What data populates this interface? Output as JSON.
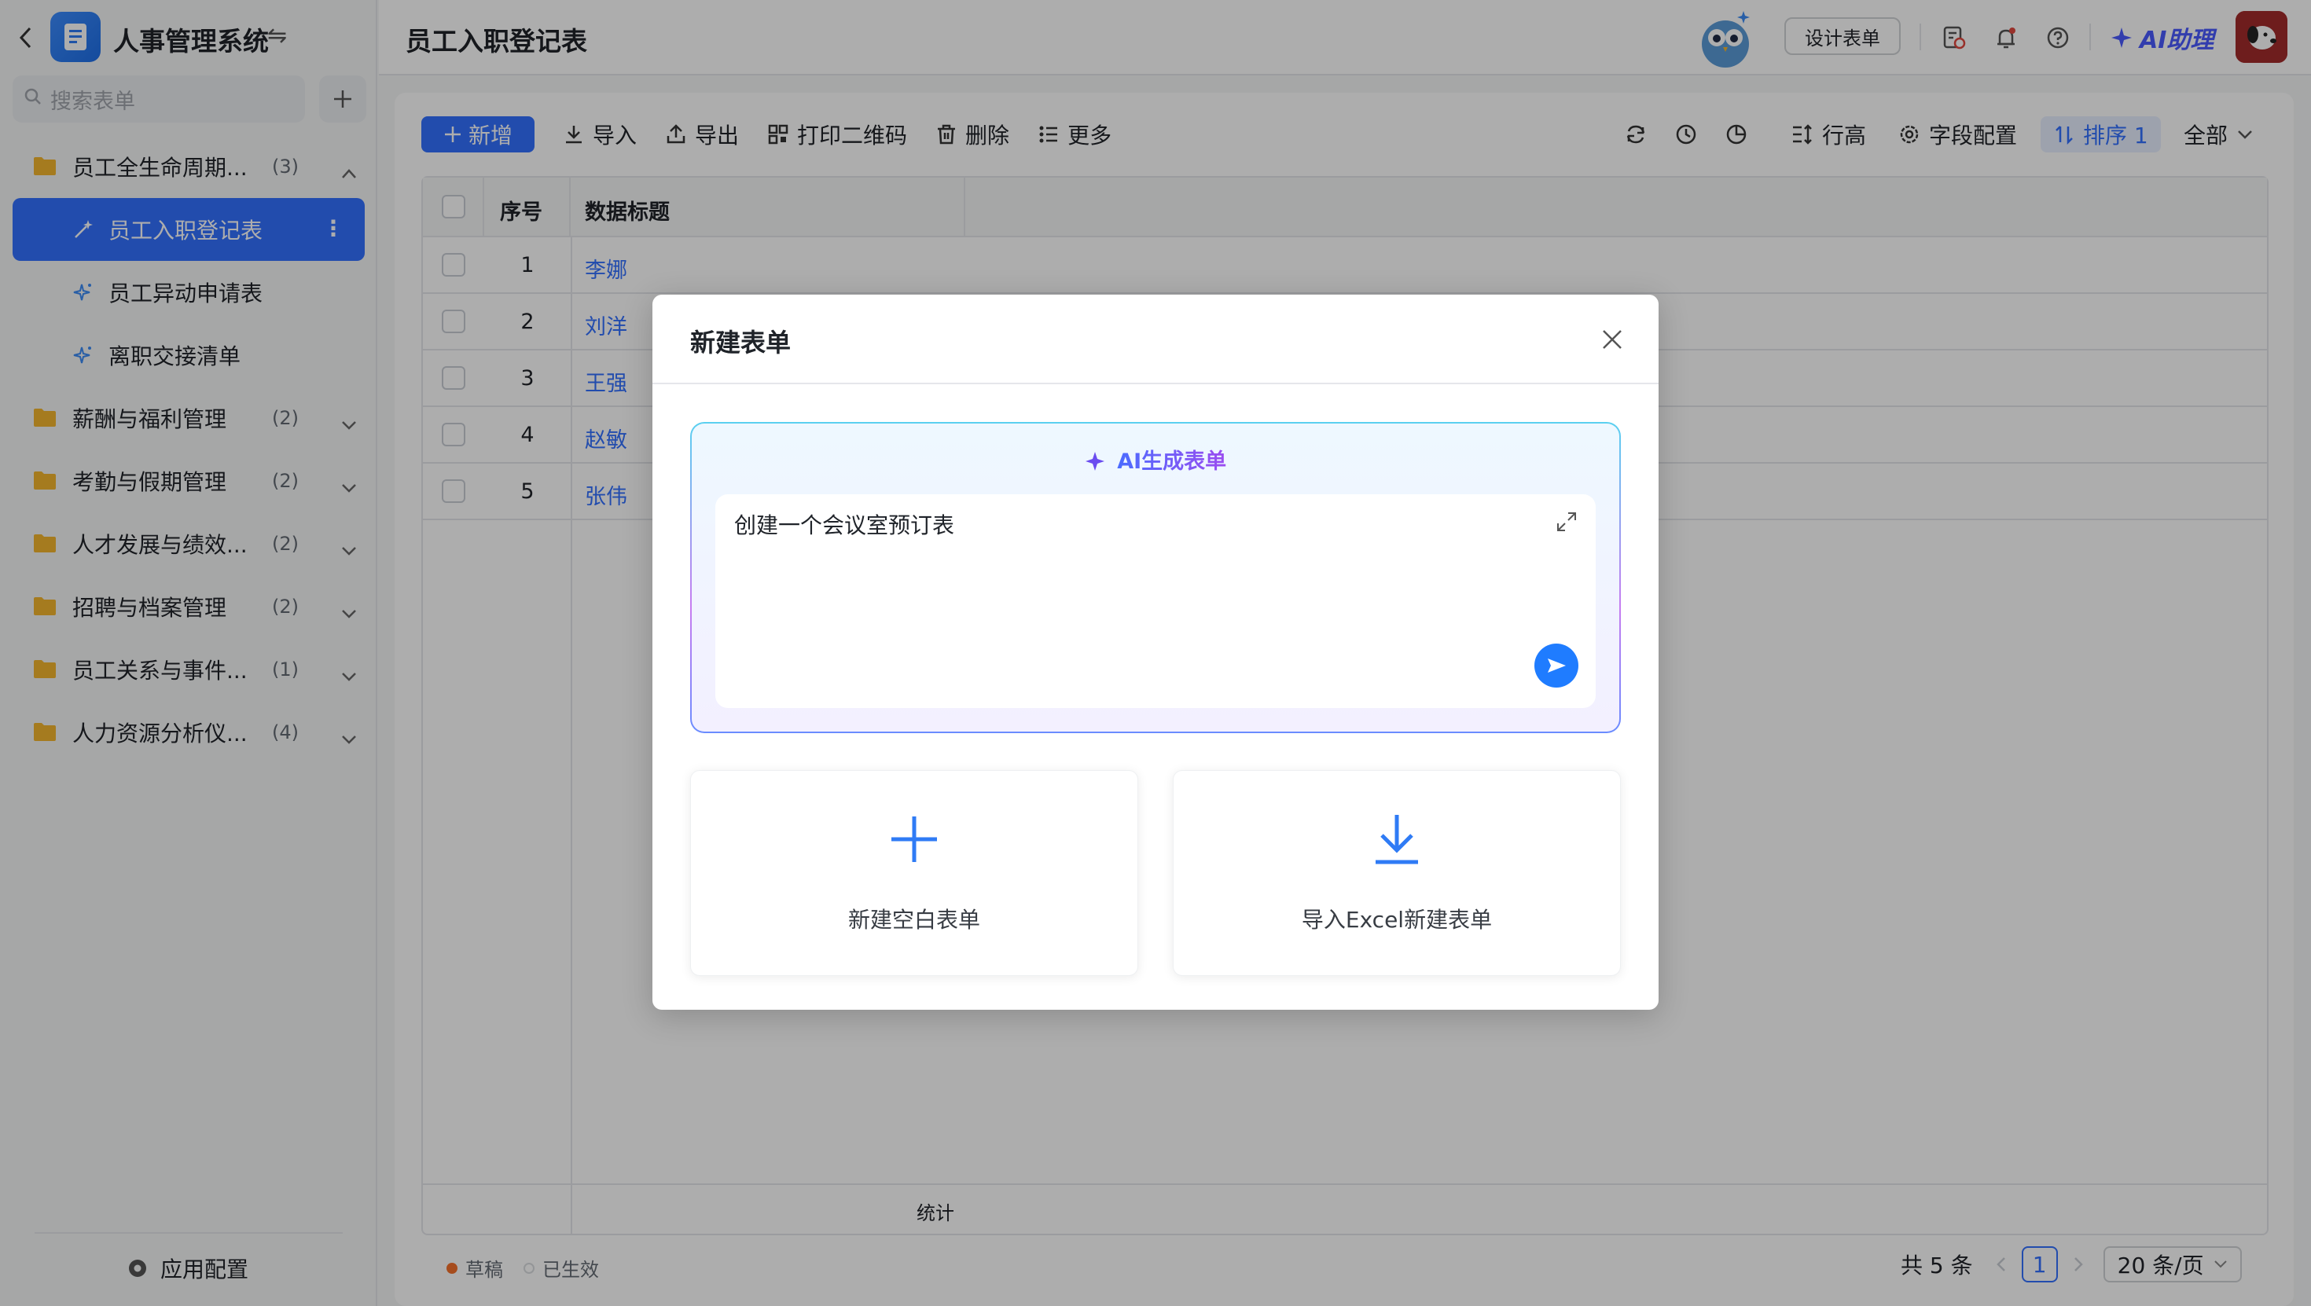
{
  "sidebar": {
    "app_name": "人事管理系统",
    "search_placeholder": "搜索表单",
    "groups": [
      {
        "label": "员工全生命周期...",
        "count": "(3)",
        "expanded": true
      },
      {
        "label": "薪酬与福利管理",
        "count": "(2)"
      },
      {
        "label": "考勤与假期管理",
        "count": "(2)"
      },
      {
        "label": "人才发展与绩效...",
        "count": "(2)"
      },
      {
        "label": "招聘与档案管理",
        "count": "(2)"
      },
      {
        "label": "员工关系与事件...",
        "count": "(1)"
      },
      {
        "label": "人力资源分析仪...",
        "count": "(4)"
      }
    ],
    "forms": [
      {
        "label": "员工入职登记表",
        "active": true
      },
      {
        "label": "员工异动申请表"
      },
      {
        "label": "离职交接清单"
      }
    ],
    "footer_label": "应用配置"
  },
  "topbar": {
    "title": "员工入职登记表",
    "design_button": "设计表单",
    "ai_assistant": "AI助理"
  },
  "toolbar": {
    "new_label": "新增",
    "import_label": "导入",
    "export_label": "导出",
    "print_qr_label": "打印二维码",
    "delete_label": "删除",
    "more_label": "更多",
    "row_height_label": "行高",
    "field_config_label": "字段配置",
    "sort_label": "排序 1",
    "filter_label": "全部"
  },
  "table": {
    "columns": [
      "序号",
      "数据标题"
    ],
    "rows": [
      {
        "num": "1",
        "title": "李娜"
      },
      {
        "num": "2",
        "title": "刘洋"
      },
      {
        "num": "3",
        "title": "王强"
      },
      {
        "num": "4",
        "title": "赵敏"
      },
      {
        "num": "5",
        "title": "张伟"
      }
    ],
    "footer_stat": "统计"
  },
  "legend": {
    "draft": "草稿",
    "active": "已生效",
    "draft_color": "#f5712c",
    "active_color": "#d9dcdf"
  },
  "pagination": {
    "total": "共 5 条",
    "current_page": "1",
    "page_size": "20 条/页"
  },
  "modal": {
    "title": "新建表单",
    "ai_title": "AI生成表单",
    "ai_input_value": "创建一个会议室预订表",
    "card_blank": "新建空白表单",
    "card_import": "导入Excel新建表单"
  },
  "colors": {
    "primary": "#3370ff",
    "ai_gradient_start": "#4b6cff",
    "ai_gradient_end": "#9b4cf0"
  }
}
